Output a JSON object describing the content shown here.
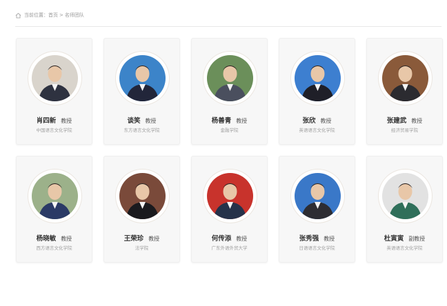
{
  "breadcrumb": {
    "prefix": "当前位置：",
    "home": "首页",
    "separator": ">",
    "current": "名师团队"
  },
  "colors": {
    "card_bg": "#f7f7f7",
    "ring_border": "#ebe6e0",
    "muted_text": "#a0a0a0"
  },
  "teachers": [
    {
      "name": "肖四新",
      "title": "教授",
      "dept": "中国语言文化学院",
      "photo_bg": "#d9d4cc",
      "suit": "#2e3240"
    },
    {
      "name": "谈笑",
      "title": "教授",
      "dept": "东方语言文化学院",
      "photo_bg": "#3c84c9",
      "suit": "#22263a"
    },
    {
      "name": "杨善青",
      "title": "教授",
      "dept": "金融学院",
      "photo_bg": "#6b8f5a",
      "suit": "#4a4f5e"
    },
    {
      "name": "张欣",
      "title": "教授",
      "dept": "英语语言文化学院",
      "photo_bg": "#3d7fd0",
      "suit": "#1f1f28"
    },
    {
      "name": "张建武",
      "title": "教授",
      "dept": "经济贸易学院",
      "photo_bg": "#8a5a3a",
      "suit": "#2b2b30"
    },
    {
      "name": "杨晓敏",
      "title": "教授",
      "dept": "西方语言文化学院",
      "photo_bg": "#9cb18a",
      "suit": "#2a3a66"
    },
    {
      "name": "王荣珍",
      "title": "教授",
      "dept": "法学院",
      "photo_bg": "#7a4a3a",
      "suit": "#1a1a1e"
    },
    {
      "name": "何传添",
      "title": "教授",
      "dept": "广东外语外贸大学",
      "photo_bg": "#c8332c",
      "suit": "#26324a"
    },
    {
      "name": "张秀强",
      "title": "教授",
      "dept": "日语语言文化学院",
      "photo_bg": "#3a78c8",
      "suit": "#2d2d33"
    },
    {
      "name": "杜寅寅",
      "title": "副教授",
      "dept": "英语语言文化学院",
      "photo_bg": "#e2e2e2",
      "suit": "#2f6f5a"
    }
  ]
}
